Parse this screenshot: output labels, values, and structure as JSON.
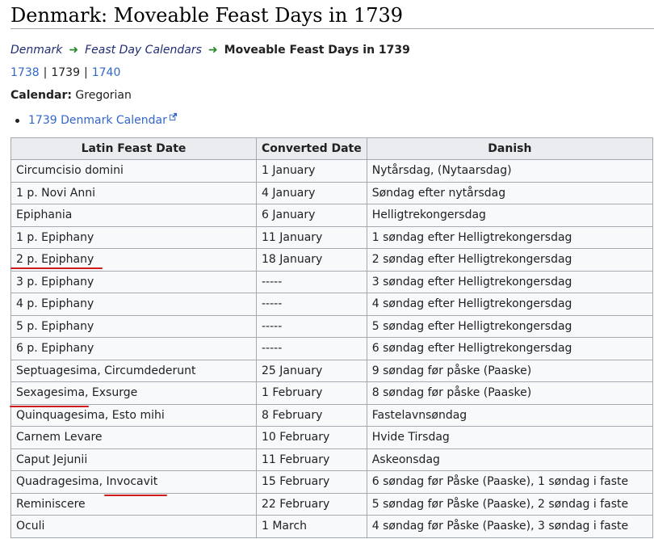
{
  "page": {
    "title": "Denmark: Moveable Feast Days in 1739",
    "breadcrumb": {
      "root": "Denmark",
      "parent": "Feast Day Calendars",
      "current": "Moveable Feast Days in 1739"
    },
    "years": {
      "prev": "1738",
      "current": "1739",
      "next": "1740"
    },
    "calendar_label": "Calendar:",
    "calendar_value": "Gregorian",
    "calendar_link": "1739 Denmark Calendar"
  },
  "table": {
    "headers": [
      "Latin Feast Date",
      "Converted Date",
      "Danish"
    ],
    "rows": [
      [
        "Circumcisio domini",
        "1 January",
        "Nytårsdag, (Nytaarsdag)"
      ],
      [
        "1 p. Novi Anni",
        "4 January",
        "Søndag efter nytårsdag"
      ],
      [
        "Epiphania",
        "6 January",
        "Helligtrekongersdag"
      ],
      [
        "1 p. Epiphany",
        "11 January",
        "1 søndag efter Helligtrekongersdag"
      ],
      [
        "2 p. Epiphany",
        "18 January",
        "2 søndag efter Helligtrekongersdag"
      ],
      [
        "3 p. Epiphany",
        "-----",
        "3 søndag efter Helligtrekongersdag"
      ],
      [
        "4 p. Epiphany",
        "-----",
        "4 søndag efter Helligtrekongersdag"
      ],
      [
        "5 p. Epiphany",
        "-----",
        "5 søndag efter Helligtrekongersdag"
      ],
      [
        "6 p. Epiphany",
        "-----",
        "6 søndag efter Helligtrekongersdag"
      ],
      [
        "Septuagesima, Circumdederunt",
        "25 January",
        "9 søndag før påske (Paaske)"
      ],
      [
        "Sexagesima, Exsurge",
        "1 February",
        "8 søndag før påske (Paaske)"
      ],
      [
        "Quinquagesima, Esto mihi",
        "8 February",
        "Fastelavnsøndag"
      ],
      [
        "Carnem Levare",
        "10 February",
        "Hvide Tirsdag"
      ],
      [
        "Caput Jejunii",
        "11 February",
        "Askeonsdag"
      ],
      [
        "Quadragesima, Invocavit",
        "15 February",
        "6 søndag før Påske (Paaske), 1 søndag i faste"
      ],
      [
        "Reminiscere",
        "22 February",
        "5 søndag før Påske (Paaske), 2 søndag i faste"
      ],
      [
        "Oculi",
        "1 March",
        "4 søndag før Påske (Paaske), 3 søndag i faste"
      ]
    ]
  },
  "colors": {
    "link": "#3366cc",
    "breadcrumb_link": "#202c74",
    "arrow": "#2a8a2a",
    "annotation": "#d11a1a"
  },
  "icons": {
    "breadcrumb_separator": "arrow-right-icon",
    "external_link": "external-link-icon"
  }
}
